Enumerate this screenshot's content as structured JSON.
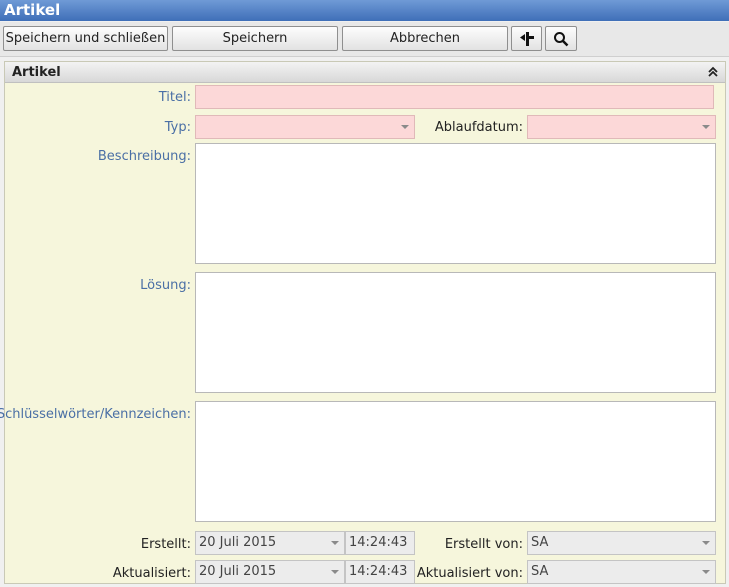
{
  "window": {
    "title": "Artikel"
  },
  "toolbar": {
    "save_close_label": "Speichern und schließen",
    "save_label": "Speichern",
    "cancel_label": "Abbrechen"
  },
  "section": {
    "title": "Artikel"
  },
  "form": {
    "title_label": "Titel:",
    "title_value": "",
    "type_label": "Typ:",
    "type_value": "",
    "expiry_label": "Ablaufdatum:",
    "expiry_value": "",
    "description_label": "Beschreibung:",
    "description_value": "",
    "solution_label": "Lösung:",
    "solution_value": "",
    "keywords_label": "Schlüsselwörter/Kennzeichen:",
    "keywords_value": "",
    "created_label": "Erstellt:",
    "created_date": "20 Juli 2015",
    "created_time": "14:24:43",
    "created_by_label": "Erstellt von:",
    "created_by_value": "SA",
    "updated_label": "Aktualisiert:",
    "updated_date": "20 Juli 2015",
    "updated_time": "14:24:43",
    "updated_by_label": "Aktualisiert von:",
    "updated_by_value": "SA"
  },
  "icons": {
    "pin": "pin-icon",
    "search": "search-icon",
    "collapse": "double-chevron-up-icon",
    "dropdown": "chevron-down-icon"
  },
  "colors": {
    "titlebar": "#4a78c0",
    "required_field": "#fcd8d8",
    "section_bg": "#f6f6dc",
    "label_blue": "#4a6fa5"
  }
}
